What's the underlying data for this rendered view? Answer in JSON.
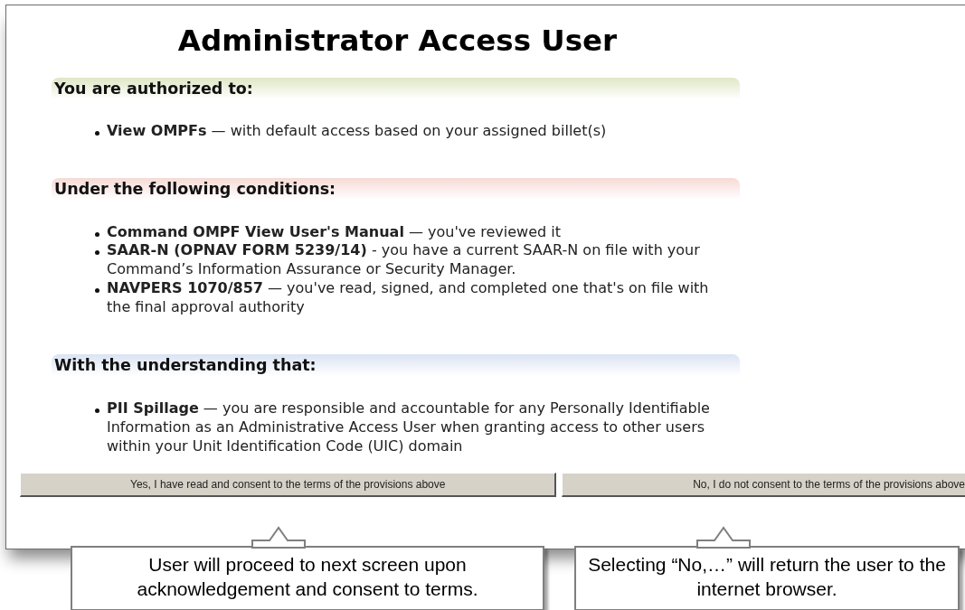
{
  "title": "Administrator Access User",
  "sections": [
    {
      "heading": "You are authorized to:",
      "color": "#dfe7c5",
      "items": [
        "**View OMPFs** — with default access based on your assigned billet(s)"
      ]
    },
    {
      "heading": "Under the following conditions:",
      "color": "#f6dad5",
      "items": [
        "**Command OMPF View User's Manual** — you've reviewed it",
        "**SAAR-N (OPNAV FORM 5239/14)** - you have a current SAAR-N on file with your Command’s Information Assurance or Security Manager.",
        "**NAVPERS 1070/857** — you've read, signed, and completed one that's on file with the final approval authority"
      ]
    },
    {
      "heading": "With the understanding that:",
      "color": "#dbe3f3",
      "items": [
        "**PII Spillage** — you are responsible and accountable for any Personally Identifiable Information as an Administrative Access User when granting access to other users within your Unit Identification Code (UIC) domain"
      ]
    }
  ],
  "buttons": [
    "Yes, I have read and consent to the terms of the provisions above",
    "No, I do not consent to the terms of the provisions above"
  ],
  "callouts": [
    "User will proceed to next screen upon acknowledgement and consent to terms.",
    "Selecting “No,…” will return the user to the internet browser."
  ]
}
